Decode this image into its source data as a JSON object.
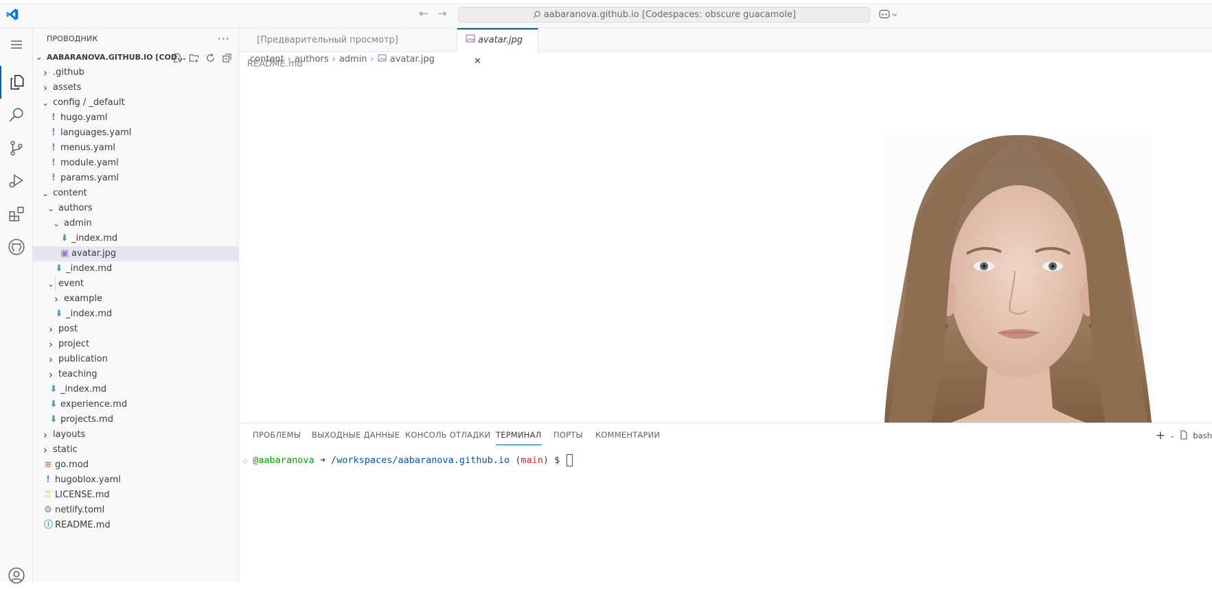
{
  "titlebar": {
    "command_center": "aabaranova.github.io [Codespaces: obscure guacamole]"
  },
  "sidebar": {
    "title": "ПРОВОДНИК",
    "root": "AABARANOVA.GITHUB.IO [COD...",
    "tree": [
      {
        "label": ".github",
        "type": "folder",
        "expanded": false
      },
      {
        "label": "assets",
        "type": "folder",
        "expanded": false
      },
      {
        "label": "config / _default",
        "type": "folder",
        "expanded": true
      },
      {
        "label": "hugo.yaml",
        "type": "yaml"
      },
      {
        "label": "languages.yaml",
        "type": "yaml"
      },
      {
        "label": "menus.yaml",
        "type": "yaml"
      },
      {
        "label": "module.yaml",
        "type": "yaml"
      },
      {
        "label": "params.yaml",
        "type": "yaml"
      },
      {
        "label": "content",
        "type": "folder",
        "expanded": true
      },
      {
        "label": "authors",
        "type": "folder",
        "expanded": true
      },
      {
        "label": "admin",
        "type": "folder",
        "expanded": true
      },
      {
        "label": "_index.md",
        "type": "md"
      },
      {
        "label": "avatar.jpg",
        "type": "image",
        "selected": true
      },
      {
        "label": "_index.md",
        "type": "md"
      },
      {
        "label": "event",
        "type": "folder",
        "expanded": true
      },
      {
        "label": "example",
        "type": "folder",
        "expanded": false
      },
      {
        "label": "_index.md",
        "type": "md"
      },
      {
        "label": "post",
        "type": "folder",
        "expanded": false
      },
      {
        "label": "project",
        "type": "folder",
        "expanded": false
      },
      {
        "label": "publication",
        "type": "folder",
        "expanded": false
      },
      {
        "label": "teaching",
        "type": "folder",
        "expanded": false
      },
      {
        "label": "_index.md",
        "type": "md"
      },
      {
        "label": "experience.md",
        "type": "md"
      },
      {
        "label": "projects.md",
        "type": "md"
      },
      {
        "label": "layouts",
        "type": "folder",
        "expanded": false
      },
      {
        "label": "static",
        "type": "folder",
        "expanded": false
      },
      {
        "label": "go.mod",
        "type": "gomod"
      },
      {
        "label": "hugoblox.yaml",
        "type": "yaml"
      },
      {
        "label": "LICENSE.md",
        "type": "license"
      },
      {
        "label": "netlify.toml",
        "type": "toml"
      },
      {
        "label": "README.md",
        "type": "info"
      }
    ]
  },
  "editor": {
    "tabs": [
      {
        "label": "[Предварительный просмотр] README.md",
        "active": false
      },
      {
        "label": "avatar.jpg",
        "active": true
      }
    ],
    "breadcrumb": [
      "content",
      "authors",
      "admin",
      "avatar.jpg"
    ]
  },
  "panel": {
    "tabs": [
      "ПРОБЛЕМЫ",
      "ВЫХОДНЫЕ ДАННЫЕ",
      "КОНСОЛЬ ОТЛАДКИ",
      "ТЕРМИНАЛ",
      "ПОРТЫ",
      "КОММЕНТАРИИ"
    ],
    "active_tab": "ТЕРМИНАЛ",
    "shell": "bash",
    "terminal": {
      "user": "@aabaranova",
      "arrow": "➜",
      "path": "/workspaces/aabaranova.github.io",
      "branch": "main",
      "prompt": "$"
    }
  },
  "colors": {
    "accent": "#005fb8",
    "selection": "#e4e6f1",
    "yaml_icon": "#a074c4",
    "md_icon": "#519aba"
  }
}
